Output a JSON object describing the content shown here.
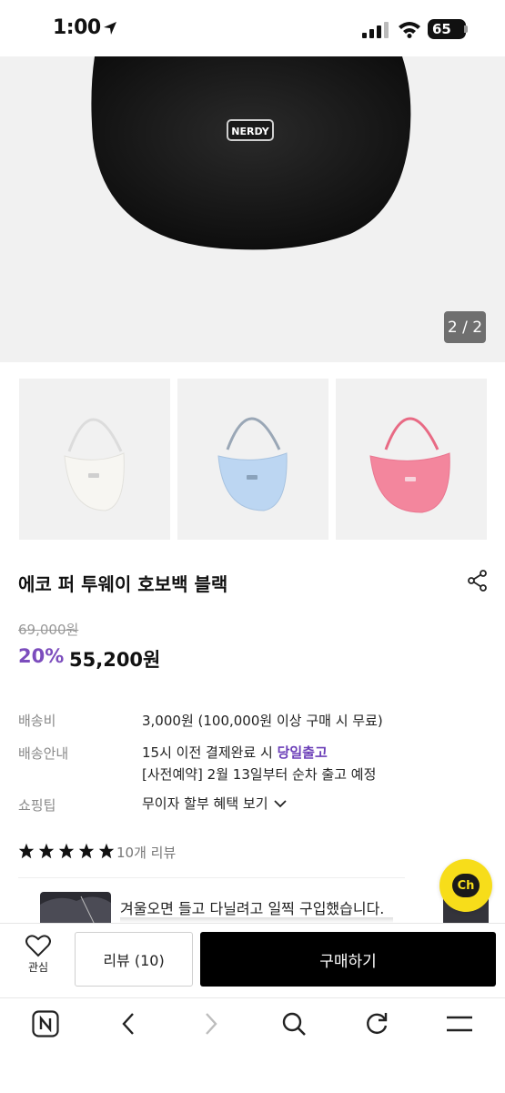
{
  "status_bar": {
    "time": "1:00",
    "battery": "65"
  },
  "hero": {
    "counter": "2 / 2",
    "logo_text": "NERDY"
  },
  "thumbnails": [
    {
      "color": "#f4f3ef"
    },
    {
      "color": "#bcd6f2"
    },
    {
      "color": "#f3869d"
    }
  ],
  "product": {
    "title": "에코 퍼 투웨이 호보백 블랙",
    "original_price": "69,000원",
    "discount": "20%",
    "price": "55,200원"
  },
  "info": {
    "shipping_fee_label": "배송비",
    "shipping_fee_value": "3,000원 (100,000원 이상 구매 시 무료)",
    "delivery_label": "배송안내",
    "delivery_line1_prefix": "15시 이전 결제완료 시 ",
    "delivery_line1_highlight": "당일출고",
    "delivery_line2": "[사전예약] 2월 13일부터 순차 출고 예정",
    "tip_label": "쇼핑팁",
    "tip_value": "무이자 할부 혜택 보기"
  },
  "reviews": {
    "rating": 5,
    "count_text": "10개 리뷰",
    "first_review_text": "겨울오면 들고 다닐려고 일찍 구입했습니다."
  },
  "chat": {
    "label": "Ch"
  },
  "action_bar": {
    "like_label": "관심",
    "review_button": "리뷰 (10)",
    "buy_button": "구매하기"
  },
  "colors": {
    "accent": "#7c4dbd",
    "chat": "#f7dd1a",
    "buy": "#000000"
  }
}
